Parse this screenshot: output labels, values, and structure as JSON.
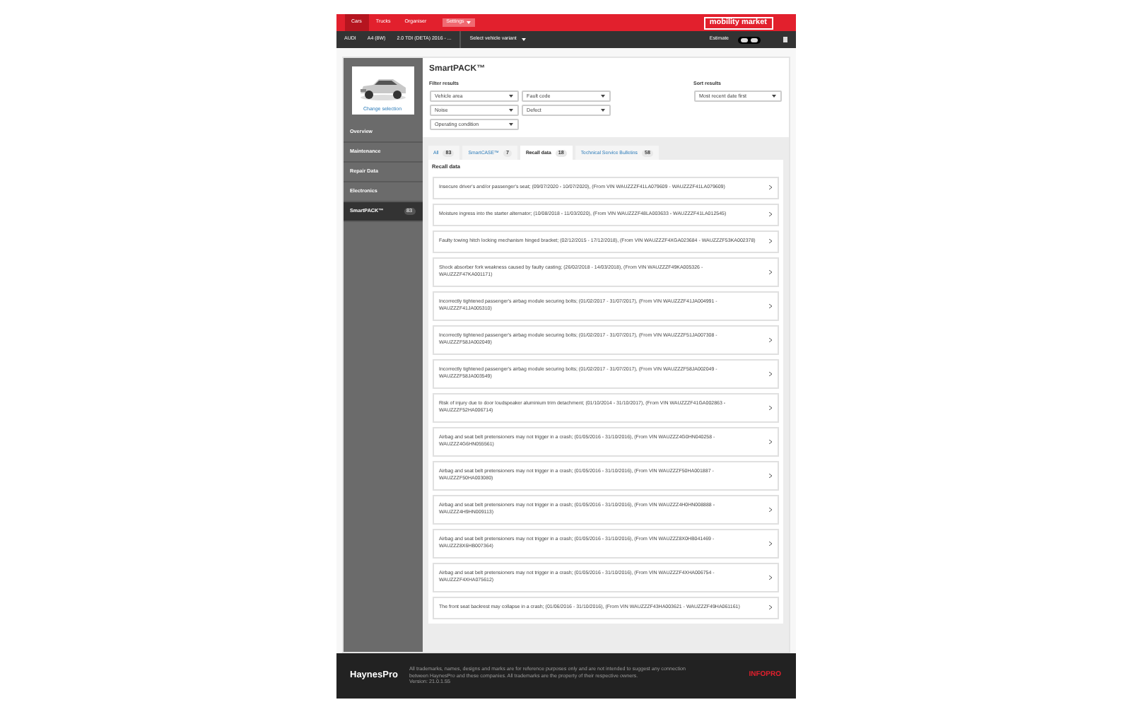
{
  "top_tabs": [
    {
      "label": "Cars",
      "selected": true
    },
    {
      "label": "Trucks",
      "selected": false
    },
    {
      "label": "Organiser",
      "selected": false
    }
  ],
  "settings_button": "Settings",
  "logo": "mobility market",
  "vehicle_bar": {
    "items": [
      "AUDI",
      "A4 (8W)",
      "2.0 TDI (DETA) 2016 - ..."
    ],
    "variant_select": "Select vehicle variant",
    "estimate_label": "Estimate"
  },
  "sidebar": {
    "change_selection": "Change selection",
    "items": [
      {
        "label": "Overview",
        "selected": false
      },
      {
        "label": "Maintenance",
        "selected": false
      },
      {
        "label": "Repair Data",
        "selected": false
      },
      {
        "label": "Electronics",
        "selected": false
      },
      {
        "label": "SmartPACK™",
        "selected": true,
        "badge": "83"
      }
    ]
  },
  "title": "SmartPACK™",
  "filter_label": "Filter results",
  "filters": [
    "Vehicle area",
    "Fault code",
    "Noise",
    "Defect",
    "Operating condition"
  ],
  "sort_label": "Sort results",
  "sort": "Most recent date first",
  "tabs": [
    {
      "label": "All",
      "count": "83",
      "selected": false
    },
    {
      "label": "SmartCASE™",
      "count": "7",
      "selected": false
    },
    {
      "label": "Recall data",
      "count": "18",
      "selected": true
    },
    {
      "label": "Technical Service Bulletins",
      "count": "58",
      "selected": false
    }
  ],
  "section_title": "Recall data",
  "recalls": [
    "Insecure driver's and/or passenger's seat; (09/07/2020 - 10/07/2020), (From VIN WAUZZZF41LA079609 - WAUZZZF41LA079609)",
    "Moisture ingress into the starter alternator; (10/08/2018 - 11/03/2020), (From VIN WAUZZZF48LA003633 - WAUZZZF41LA012545)",
    "Faulty towing hitch locking mechanism hinged bracket; (02/12/2015 - 17/12/2018), (From VIN WAUZZZF4XGA023684 - WAUZZZF53KA002378)",
    "Shock absorber fork weakness caused by faulty casting; (26/02/2018 - 14/03/2018), (From VIN WAUZZZF49KA005326 - WAUZZZF47KA001171)",
    "Incorrectly tightened passenger's airbag module securing bolts; (01/02/2017 - 31/07/2017), (From VIN WAUZZZF41JA004991 - WAUZZZF41JA005310)",
    "Incorrectly tightened passenger's airbag module securing bolts; (01/02/2017 - 31/07/2017), (From VIN WAUZZZF51JA007308 - WAUZZZF58JA002049)",
    "Incorrectly tightened passenger's airbag module securing bolts; (01/02/2017 - 31/07/2017), (From VIN WAUZZZF58JA002049 - WAUZZZF58JA003549)",
    "Risk of injury due to door loudspeaker aluminium trim detachment; (01/10/2014 - 31/10/2017), (From VIN WAUZZZF41GA002863 - WAUZZZF52HA006714)",
    "Airbag and seat belt pretensioners may not trigger in a crash; (01/05/2016 - 31/10/2016), (From VIN WAUZZZ4G0HN040258 - WAUZZZ4G6HN055561)",
    "Airbag and seat belt pretensioners may not trigger in a crash; (01/05/2016 - 31/10/2016), (From VIN WAUZZZF50HA001887 - WAUZZZF50HA003080)",
    "Airbag and seat belt pretensioners may not trigger in a crash; (01/05/2016 - 31/10/2016), (From VIN WAUZZZ4H0HN008888 - WAUZZZ4H9HN009113)",
    "Airbag and seat belt pretensioners may not trigger in a crash; (01/05/2016 - 31/10/2016), (From VIN WAUZZZ8X0HB041469 - WAUZZZ8X6HB007364)",
    "Airbag and seat belt pretensioners may not trigger in a crash; (01/05/2016 - 31/10/2016), (From VIN WAUZZZF4XHA006754 - WAUZZZF4XHA075612)",
    "The front seat backrest may collapse in a crash; (01/06/2016 - 31/10/2016), (From VIN WAUZZZF43HA003621 - WAUZZZF49HA061161)"
  ],
  "footer": {
    "logo": "HaynesPro",
    "notice": "All trademarks, names, designs and marks are for reference purposes only and are not intended to suggest any connection between HaynesPro and these companies. All trademarks are the property of their respective owners.",
    "version": "Version: 21.0.1.55",
    "partner": "INFOPRO"
  }
}
